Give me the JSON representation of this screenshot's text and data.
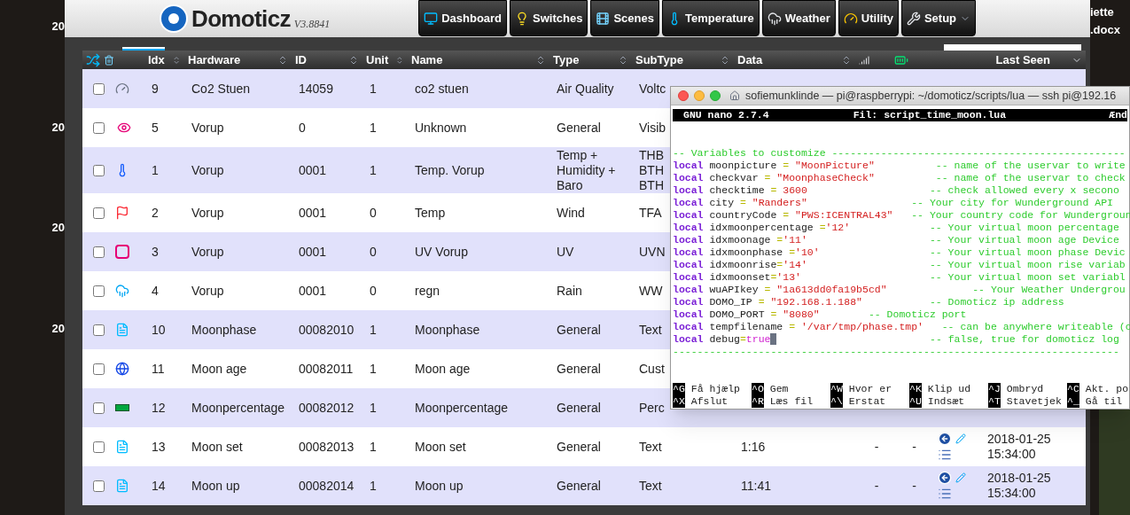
{
  "desktop": {
    "left_labels": [
      "20",
      "20",
      "20",
      "20"
    ],
    "right_labels": [
      "iette",
      ".docx"
    ]
  },
  "header": {
    "logo": "Domoticz",
    "version": "V3.8841",
    "nav": [
      {
        "label": "Dashboard",
        "dropdown": false
      },
      {
        "label": "Switches",
        "dropdown": false
      },
      {
        "label": "Scenes",
        "dropdown": false
      },
      {
        "label": "Temperature",
        "dropdown": false
      },
      {
        "label": "Weather",
        "dropdown": false
      },
      {
        "label": "Utility",
        "dropdown": false
      },
      {
        "label": "Setup",
        "dropdown": true
      }
    ]
  },
  "table": {
    "columns": [
      "Idx",
      "Hardware",
      "ID",
      "Unit",
      "Name",
      "Type",
      "SubType",
      "Data",
      "Last Seen"
    ],
    "rows": [
      {
        "checked": false,
        "kind": "air",
        "idx": "9",
        "hardware": "Co2 Stuen",
        "id": "14059",
        "unit": "1",
        "name": "co2 stuen",
        "type": "Air Quality",
        "subtype": "Voltc"
      },
      {
        "checked": false,
        "kind": "eye",
        "idx": "5",
        "hardware": "Vorup",
        "id": "0",
        "unit": "1",
        "name": "Unknown",
        "type": "General",
        "subtype": "Visib"
      },
      {
        "checked": false,
        "kind": "thermo",
        "idx": "1",
        "hardware": "Vorup",
        "id": "0001",
        "unit": "1",
        "name": "Temp. Vorup",
        "type": "Temp + Humidity + Baro",
        "subtype": "THB BTH BTH"
      },
      {
        "checked": false,
        "kind": "wind",
        "idx": "2",
        "hardware": "Vorup",
        "id": "0001",
        "unit": "0",
        "name": "Temp",
        "type": "Wind",
        "subtype": "TFA"
      },
      {
        "checked": false,
        "kind": "uv",
        "idx": "3",
        "hardware": "Vorup",
        "id": "0001",
        "unit": "0",
        "name": "UV Vorup",
        "type": "UV",
        "subtype": "UVN"
      },
      {
        "checked": false,
        "kind": "rain",
        "idx": "4",
        "hardware": "Vorup",
        "id": "0001",
        "unit": "0",
        "name": "regn",
        "type": "Rain",
        "subtype": "WW"
      },
      {
        "checked": false,
        "kind": "text",
        "idx": "10",
        "hardware": "Moonphase",
        "id": "00082010",
        "unit": "1",
        "name": "Moonphase",
        "type": "General",
        "subtype": "Text"
      },
      {
        "checked": false,
        "kind": "globe",
        "idx": "11",
        "hardware": "Moon age",
        "id": "00082011",
        "unit": "1",
        "name": "Moon age",
        "type": "General",
        "subtype": "Cust"
      },
      {
        "checked": false,
        "kind": "percent",
        "idx": "12",
        "hardware": "Moonpercentage",
        "id": "00082012",
        "unit": "1",
        "name": "Moonpercentage",
        "type": "General",
        "subtype": "Perc"
      },
      {
        "checked": false,
        "kind": "text",
        "idx": "13",
        "hardware": "Moon set",
        "id": "00082013",
        "unit": "1",
        "name": "Moon set",
        "type": "General",
        "subtype": "Text",
        "data": "1:16",
        "signal": "-",
        "battery": "-",
        "last_seen": "2018-01-25 15:34:00"
      },
      {
        "checked": false,
        "kind": "text",
        "idx": "14",
        "hardware": "Moon up",
        "id": "00082014",
        "unit": "1",
        "name": "Moon up",
        "type": "General",
        "subtype": "Text",
        "data": "11:41",
        "signal": "-",
        "battery": "-",
        "last_seen": "2018-01-25 15:34:00"
      }
    ]
  },
  "terminal": {
    "title": "sofiemunklinde — pi@raspberrypi: ~/domoticz/scripts/lua — ssh pi@192.16",
    "nano_version": "GNU nano 2.7.4",
    "file": "Fil: script_time_moon.lua",
    "status": "Ænd",
    "lines": [
      {
        "kind": "comment",
        "text": "-- Variables to customize ------------------------------------------------"
      },
      {
        "kind": "string",
        "keyword": "local",
        "name": "moonpicture",
        "op": " = ",
        "value": "\"MoonPicture\"",
        "comment": "          -- name of the uservar to write"
      },
      {
        "kind": "string",
        "keyword": "local",
        "name": "checkvar",
        "op": " = ",
        "value": "\"MoonphaseCheck\"",
        "comment": "          -- name of the uservar to check"
      },
      {
        "kind": "number",
        "keyword": "local",
        "name": "checktime",
        "op": " = ",
        "value": "3600",
        "comment": "                    -- check allowed every x secono"
      },
      {
        "kind": "string",
        "keyword": "local",
        "name": "city",
        "op": " = ",
        "value": "\"Randers\"",
        "comment": "                 -- Your city for Wunderground API"
      },
      {
        "kind": "string",
        "keyword": "local",
        "name": "countryCode",
        "op": " = ",
        "value": "\"PWS:ICENTRAL43\"",
        "comment": "   -- Your country code for Wundergroun"
      },
      {
        "kind": "string",
        "keyword": "local",
        "name": "idxmoonpercentage",
        "op": " =",
        "value": "'12'",
        "comment": "             -- Your virtual moon percentage"
      },
      {
        "kind": "string",
        "keyword": "local",
        "name": "idxmoonage",
        "op": " =",
        "value": "'11'",
        "comment": "                    -- Your virtual moon age Device"
      },
      {
        "kind": "string",
        "keyword": "local",
        "name": "idxmoonphase",
        "op": " =",
        "value": "'10'",
        "comment": "                  -- Your virtual moon phase Devic"
      },
      {
        "kind": "string",
        "keyword": "local",
        "name": "idxmoonrise",
        "op": "=",
        "value": "'14'",
        "comment": "                    -- Your virtual moon rise variab"
      },
      {
        "kind": "string",
        "keyword": "local",
        "name": "idxmoonset",
        "op": "=",
        "value": "'13'",
        "comment": "                     -- Your virtual moon set variabl"
      },
      {
        "kind": "string",
        "keyword": "local",
        "name": "wuAPIkey",
        "op": " = ",
        "value": "\"1a613dd0fa19b5cd\"",
        "comment": "              -- Your Weather Undergrou"
      },
      {
        "kind": "string",
        "keyword": "local",
        "name": "DOMO_IP",
        "op": " = ",
        "value": "\"192.168.1.188\"",
        "comment": "           -- Domoticz ip address"
      },
      {
        "kind": "string",
        "keyword": "local",
        "name": "DOMO_PORT",
        "op": " = ",
        "value": "\"8080\"",
        "comment": "        -- Domoticz port"
      },
      {
        "kind": "string",
        "keyword": "local",
        "name": "tempfilename",
        "op": " = ",
        "value": "'/var/tmp/phase.tmp'",
        "comment": "   -- can be anywhere writeable (c"
      },
      {
        "kind": "bool",
        "keyword": "local",
        "name": "debug",
        "op": "=",
        "value": "true",
        "cursor": true,
        "comment": "                         -- false, true for domoticz log"
      },
      {
        "kind": "comment",
        "text": "-------------------------------------------------------------------------"
      }
    ],
    "shortcuts": [
      [
        {
          "key": "^G",
          "label": "Få hjælp"
        },
        {
          "key": "^O",
          "label": "Gem"
        },
        {
          "key": "^W",
          "label": "Hvor er"
        },
        {
          "key": "^K",
          "label": "Klip ud"
        },
        {
          "key": "^J",
          "label": "Ombryd"
        },
        {
          "key": "^C",
          "label": "Akt. po"
        }
      ],
      [
        {
          "key": "^X",
          "label": "Afslut"
        },
        {
          "key": "^R",
          "label": "Læs fil"
        },
        {
          "key": "^\\",
          "label": "Erstat"
        },
        {
          "key": "^U",
          "label": "Indsæt"
        },
        {
          "key": "^T",
          "label": "Stavetjek"
        },
        {
          "key": "^_",
          "label": "Gå til"
        }
      ]
    ]
  }
}
